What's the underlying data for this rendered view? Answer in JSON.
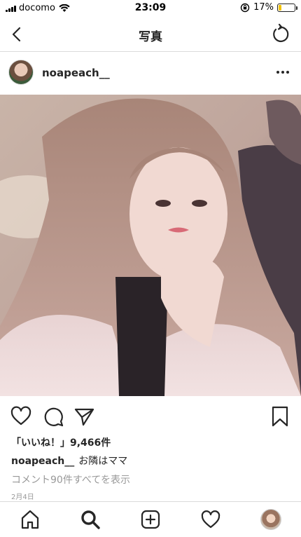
{
  "status_bar": {
    "carrier": "docomo",
    "time": "23:09",
    "battery_percent_label": "17%",
    "battery_level": 0.17,
    "battery_color": "#f2c200"
  },
  "nav": {
    "title": "写真",
    "back_icon": "chevron-left-icon",
    "refresh_icon": "refresh-icon"
  },
  "post": {
    "username": "noapeach__",
    "more_icon": "more-horizontal-icon",
    "photo_icon": "post-photo",
    "likes": "「いいね！」9,466件",
    "caption_username": "noapeach__",
    "caption_text": "お隣はママ",
    "view_comments": "コメント90件すべてを表示",
    "date": "2月4日"
  },
  "actions": {
    "icons": [
      "heart-icon",
      "comment-icon",
      "share-icon",
      "bookmark-icon"
    ]
  },
  "tab_bar": {
    "icons": [
      "home-icon",
      "search-icon",
      "add-post-icon",
      "activity-heart-icon",
      "profile-avatar"
    ]
  },
  "colors": {
    "text": "#262626",
    "secondary_text": "#999999",
    "divider": "#dbdbdb"
  }
}
